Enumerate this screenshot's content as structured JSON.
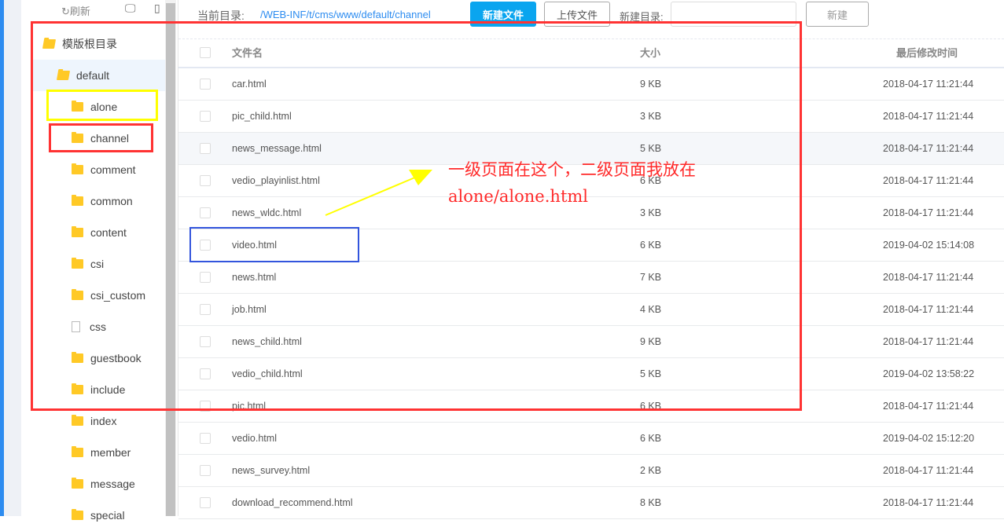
{
  "sidebar": {
    "refresh": "刷新",
    "desktop_icon": "desktop-icon",
    "mobile_icon": "mobile-icon",
    "root": "模版根目录",
    "current": "default",
    "folders": [
      {
        "name": "alone",
        "type": "folder"
      },
      {
        "name": "channel",
        "type": "folder"
      },
      {
        "name": "comment",
        "type": "folder"
      },
      {
        "name": "common",
        "type": "folder"
      },
      {
        "name": "content",
        "type": "folder"
      },
      {
        "name": "csi",
        "type": "folder"
      },
      {
        "name": "csi_custom",
        "type": "folder"
      },
      {
        "name": "css",
        "type": "file"
      },
      {
        "name": "guestbook",
        "type": "folder"
      },
      {
        "name": "include",
        "type": "folder"
      },
      {
        "name": "index",
        "type": "folder"
      },
      {
        "name": "member",
        "type": "folder"
      },
      {
        "name": "message",
        "type": "folder"
      },
      {
        "name": "special",
        "type": "folder"
      }
    ]
  },
  "toolbar": {
    "current_dir_label": "当前目录:",
    "current_dir": "/WEB-INF/t/cms/www/default/channel",
    "new_file": "新建文件",
    "upload": "上传文件",
    "new_dir_label": "新建目录:",
    "new_dir_value": "",
    "create": "新建"
  },
  "table": {
    "headers": {
      "name": "文件名",
      "size": "大小",
      "modified": "最后修改时间"
    },
    "rows": [
      {
        "name": "car.html",
        "size": "9 KB",
        "modified": "2018-04-17 11:21:44"
      },
      {
        "name": "pic_child.html",
        "size": "3 KB",
        "modified": "2018-04-17 11:21:44"
      },
      {
        "name": "news_message.html",
        "size": "5 KB",
        "modified": "2018-04-17 11:21:44"
      },
      {
        "name": "vedio_playinlist.html",
        "size": "6 KB",
        "modified": "2018-04-17 11:21:44"
      },
      {
        "name": "news_wldc.html",
        "size": "3 KB",
        "modified": "2018-04-17 11:21:44"
      },
      {
        "name": "video.html",
        "size": "6 KB",
        "modified": "2019-04-02 15:14:08"
      },
      {
        "name": "news.html",
        "size": "7 KB",
        "modified": "2018-04-17 11:21:44"
      },
      {
        "name": "job.html",
        "size": "4 KB",
        "modified": "2018-04-17 11:21:44"
      },
      {
        "name": "news_child.html",
        "size": "9 KB",
        "modified": "2018-04-17 11:21:44"
      },
      {
        "name": "vedio_child.html",
        "size": "5 KB",
        "modified": "2019-04-02 13:58:22"
      },
      {
        "name": "pic.html",
        "size": "6 KB",
        "modified": "2018-04-17 11:21:44"
      },
      {
        "name": "vedio.html",
        "size": "6 KB",
        "modified": "2019-04-02 15:12:20"
      },
      {
        "name": "news_survey.html",
        "size": "2 KB",
        "modified": "2018-04-17 11:21:44"
      },
      {
        "name": "download_recommend.html",
        "size": "8 KB",
        "modified": "2018-04-17 11:21:44"
      }
    ]
  },
  "annotation": {
    "line1": "一级页面在这个，二级页面我放在",
    "line2": "alone/alone.html",
    "colors": {
      "red": "#ff3333",
      "yellow": "#ffff00",
      "blue": "#3355dd"
    }
  }
}
